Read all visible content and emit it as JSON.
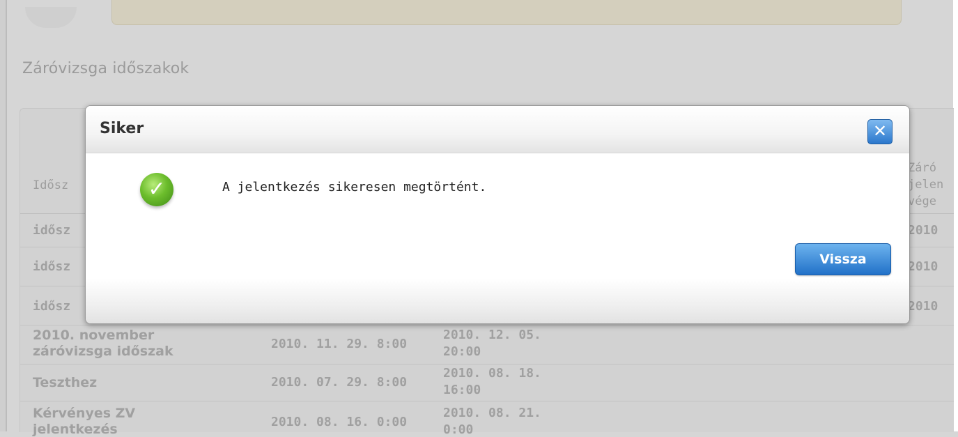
{
  "section": {
    "title": "Záróvizsga időszakok"
  },
  "table": {
    "header": {
      "col1": "Idősz",
      "col_right": [
        "Záró",
        "jelen",
        "vége"
      ]
    },
    "rows": [
      {
        "name_lines": [
          "idősz"
        ],
        "start": "",
        "end_lines": [],
        "right": "2010"
      },
      {
        "name_lines": [
          "idősz"
        ],
        "start": "",
        "end_lines": [],
        "right": "2010"
      },
      {
        "name_lines": [
          "idősz"
        ],
        "start": "",
        "end_lines": [],
        "right": "2010"
      },
      {
        "name_lines": [
          "2010. november",
          "záróvizsga időszak"
        ],
        "start": "2010. 11. 29. 8:00",
        "end_lines": [
          "2010. 12. 05.",
          "20:00"
        ],
        "right": ""
      },
      {
        "name_lines": [
          "Teszthez"
        ],
        "start": "2010. 07. 29. 8:00",
        "end_lines": [
          "2010. 08. 18.",
          "16:00"
        ],
        "right": ""
      },
      {
        "name_lines": [
          "Kérvényes ZV",
          "jelentkezés"
        ],
        "start": "2010. 08. 16. 0:00",
        "end_lines": [
          "2010. 08. 21.",
          "0:00"
        ],
        "right": ""
      }
    ]
  },
  "dialog": {
    "title": "Siker",
    "close_symbol": "✕",
    "check_symbol": "✓",
    "message": "A jelentkezés sikeresen megtörtént.",
    "back_label": "Vissza"
  },
  "icons": {
    "close": "close-icon",
    "success": "checkmark-icon"
  },
  "colors": {
    "accent": "#2b77cc",
    "success": "#6cbd2c"
  }
}
